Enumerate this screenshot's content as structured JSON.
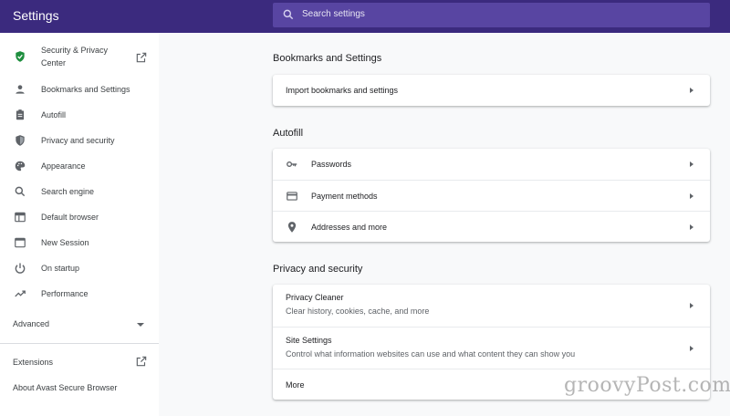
{
  "header": {
    "title": "Settings",
    "search_placeholder": "Search settings",
    "search_icon": "search-icon"
  },
  "sidebar": {
    "items": [
      {
        "label": "Security & Privacy Center",
        "icon": "shield-check-icon",
        "external": true
      },
      {
        "label": "Bookmarks and Settings",
        "icon": "person-icon"
      },
      {
        "label": "Autofill",
        "icon": "clipboard-icon"
      },
      {
        "label": "Privacy and security",
        "icon": "shield-icon"
      },
      {
        "label": "Appearance",
        "icon": "palette-icon"
      },
      {
        "label": "Search engine",
        "icon": "search-icon"
      },
      {
        "label": "Default browser",
        "icon": "browser-icon"
      },
      {
        "label": "New Session",
        "icon": "window-icon"
      },
      {
        "label": "On startup",
        "icon": "power-icon"
      },
      {
        "label": "Performance",
        "icon": "trending-up-icon"
      }
    ],
    "advanced_label": "Advanced",
    "extensions_label": "Extensions",
    "about_label": "About Avast Secure Browser"
  },
  "main": {
    "sections": [
      {
        "title": "Bookmarks and Settings",
        "rows": [
          {
            "label": "Import bookmarks and settings"
          }
        ]
      },
      {
        "title": "Autofill",
        "rows": [
          {
            "label": "Passwords",
            "icon": "key-icon"
          },
          {
            "label": "Payment methods",
            "icon": "credit-card-icon"
          },
          {
            "label": "Addresses and more",
            "icon": "location-pin-icon"
          }
        ]
      },
      {
        "title": "Privacy and security",
        "rows": [
          {
            "label": "Privacy Cleaner",
            "sub": "Clear history, cookies, cache, and more"
          },
          {
            "label": "Site Settings",
            "sub": "Control what information websites can use and what content they can show you"
          },
          {
            "label": "More"
          }
        ]
      }
    ]
  },
  "watermark": "groovyPost.com",
  "colors": {
    "header_bg": "#3b2a7e",
    "search_bg": "#5845a2",
    "shield_green": "#1e8e3e"
  }
}
